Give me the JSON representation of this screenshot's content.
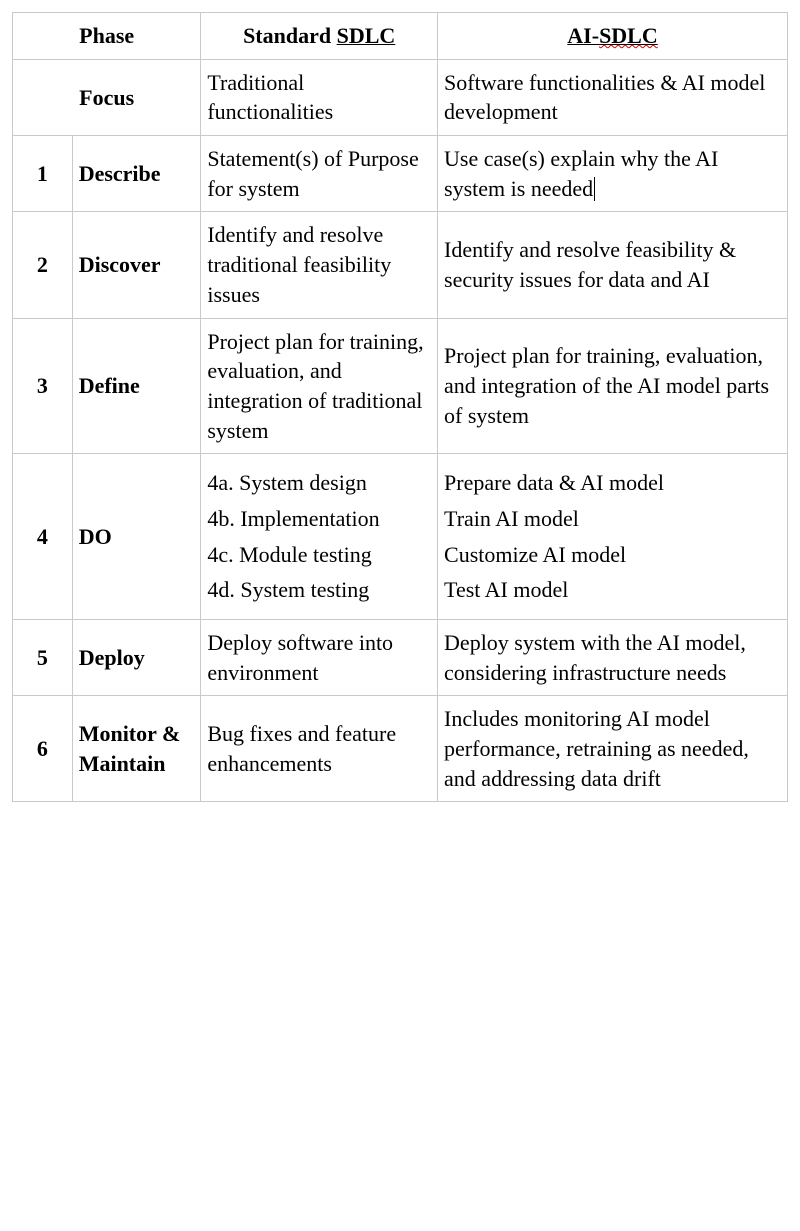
{
  "header": {
    "phase": "Phase",
    "std_prefix": "Standard ",
    "std_acronym": "SDLC",
    "ai_prefix": "AI-",
    "ai_acronym": "SDLC"
  },
  "focus": {
    "label": "Focus",
    "std": "Traditional functionalities",
    "ai": "Software functionalities & AI model development"
  },
  "rows": [
    {
      "num": "1",
      "name": "Describe",
      "std": "Statement(s) of Purpose for system",
      "ai": "Use case(s) explain why the AI system is needed"
    },
    {
      "num": "2",
      "name": "Discover",
      "std": "Identify and resolve traditional feasibility issues",
      "ai": "Identify and resolve feasibility & security issues for data and AI"
    },
    {
      "num": "3",
      "name": "Define",
      "std": "Project plan for training, evaluation, and integration of traditional system",
      "ai": "Project plan for training, evaluation, and integration of the AI model parts of system"
    },
    {
      "num": "4",
      "name": "DO",
      "std_lines": [
        "4a. System design",
        "4b. Implementation",
        "4c. Module testing",
        "4d. System testing"
      ],
      "ai_lines": [
        "Prepare data & AI model",
        "Train AI model",
        "Customize AI model",
        "Test AI model"
      ]
    },
    {
      "num": "5",
      "name": "Deploy",
      "std": "Deploy software into environment",
      "ai": "Deploy system with the AI model, considering infrastructure needs"
    },
    {
      "num": "6",
      "name": "Monitor & Maintain",
      "std": "Bug fixes and feature enhancements",
      "ai": "Includes monitoring AI model performance, retraining as needed, and addressing data drift"
    }
  ]
}
